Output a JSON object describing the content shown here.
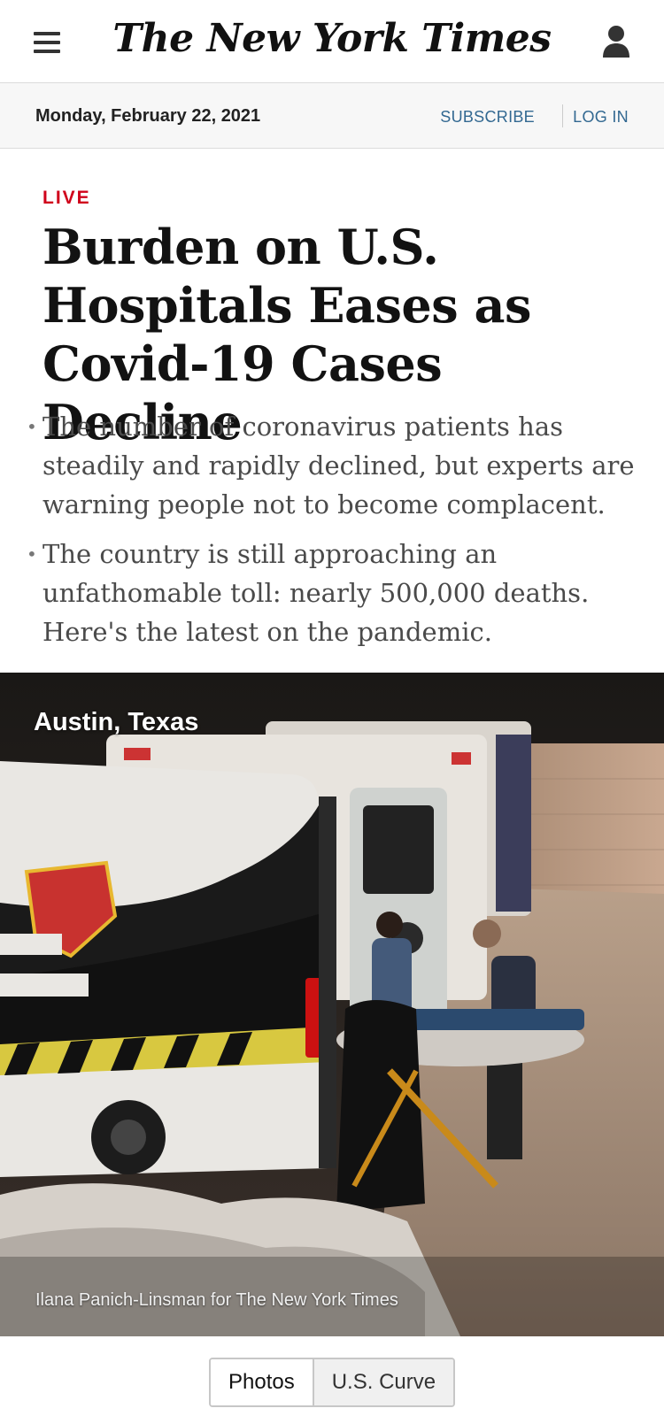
{
  "header": {
    "logo": "The New York Times",
    "icons": {
      "menu": "hamburger-menu-icon",
      "user": "user-account-icon"
    }
  },
  "date_bar": {
    "date": "Monday, February 22, 2021",
    "subscribe": "SUBSCRIBE",
    "login": "LOG IN"
  },
  "article": {
    "label": "LIVE",
    "headline": "Burden on U.S. Hospitals Eases as Covid-19 Cases Decline",
    "bullets": [
      "The number of coronavirus patients has steadily and rapidly declined, but experts are warning people not to become complacent.",
      "The country is still approaching an unfathomable toll: nearly 500,000 deaths. Here's the latest on the pandemic."
    ]
  },
  "photo": {
    "location": "Austin, Texas",
    "credit": "Ilana Panich-Linsman for The New York Times"
  },
  "tabs": [
    {
      "label": "Photos",
      "active": true
    },
    {
      "label": "U.S. Curve",
      "active": false
    }
  ],
  "colors": {
    "live_red": "#d0021b",
    "link_blue": "#326891",
    "text_dark": "#121212",
    "summary_gray": "#4a4a4a"
  }
}
